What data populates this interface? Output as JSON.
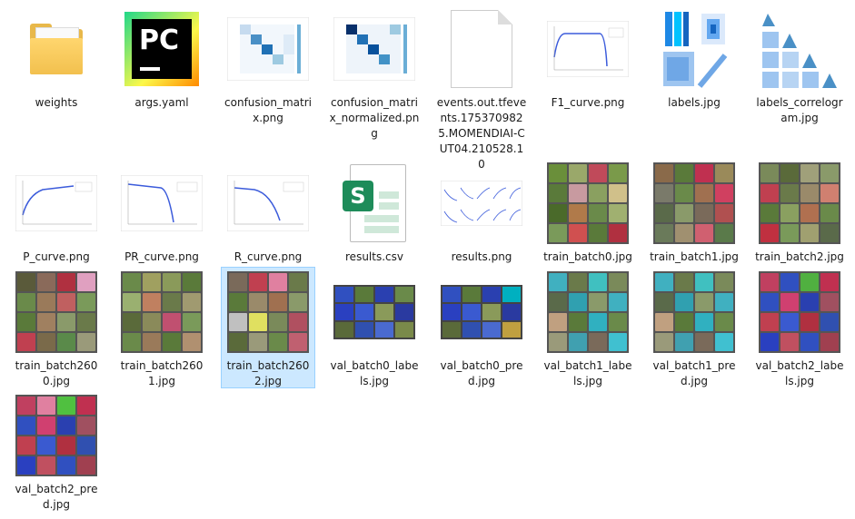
{
  "files": [
    {
      "name": "weights",
      "icon": "folder-icon"
    },
    {
      "name": "args.yaml",
      "icon": "pycharm-icon"
    },
    {
      "name": "confusion_matrix.png",
      "icon": "image-thumbnail"
    },
    {
      "name": "confusion_matrix_normalized.png",
      "icon": "image-thumbnail"
    },
    {
      "name": "events.out.tfevents.1753709825.MOMENDIAI-CUT04.210528.10",
      "icon": "file-icon"
    },
    {
      "name": "F1_curve.png",
      "icon": "image-thumbnail"
    },
    {
      "name": "labels.jpg",
      "icon": "image-thumbnail"
    },
    {
      "name": "labels_correlogram.jpg",
      "icon": "image-thumbnail"
    },
    {
      "name": "P_curve.png",
      "icon": "image-thumbnail"
    },
    {
      "name": "PR_curve.png",
      "icon": "image-thumbnail"
    },
    {
      "name": "R_curve.png",
      "icon": "image-thumbnail"
    },
    {
      "name": "results.csv",
      "icon": "spreadsheet-icon"
    },
    {
      "name": "results.png",
      "icon": "image-thumbnail"
    },
    {
      "name": "train_batch0.jpg",
      "icon": "image-thumbnail"
    },
    {
      "name": "train_batch1.jpg",
      "icon": "image-thumbnail"
    },
    {
      "name": "train_batch2.jpg",
      "icon": "image-thumbnail"
    },
    {
      "name": "train_batch2600.jpg",
      "icon": "image-thumbnail"
    },
    {
      "name": "train_batch2601.jpg",
      "icon": "image-thumbnail"
    },
    {
      "name": "train_batch2602.jpg",
      "icon": "image-thumbnail"
    },
    {
      "name": "val_batch0_labels.jpg",
      "icon": "image-thumbnail"
    },
    {
      "name": "val_batch0_pred.jpg",
      "icon": "image-thumbnail"
    },
    {
      "name": "val_batch1_labels.jpg",
      "icon": "image-thumbnail"
    },
    {
      "name": "val_batch1_pred.jpg",
      "icon": "image-thumbnail"
    },
    {
      "name": "val_batch2_labels.jpg",
      "icon": "image-thumbnail"
    },
    {
      "name": "val_batch2_pred.jpg",
      "icon": "image-thumbnail"
    }
  ],
  "selected_file": "train_batch2602.jpg",
  "colors": {
    "selection_bg": "#cce8ff",
    "selection_border": "#99d1ff",
    "folder": "#ffd66e",
    "csv_green": "#1e8c5a",
    "plot_line": "#3b5bdb"
  }
}
